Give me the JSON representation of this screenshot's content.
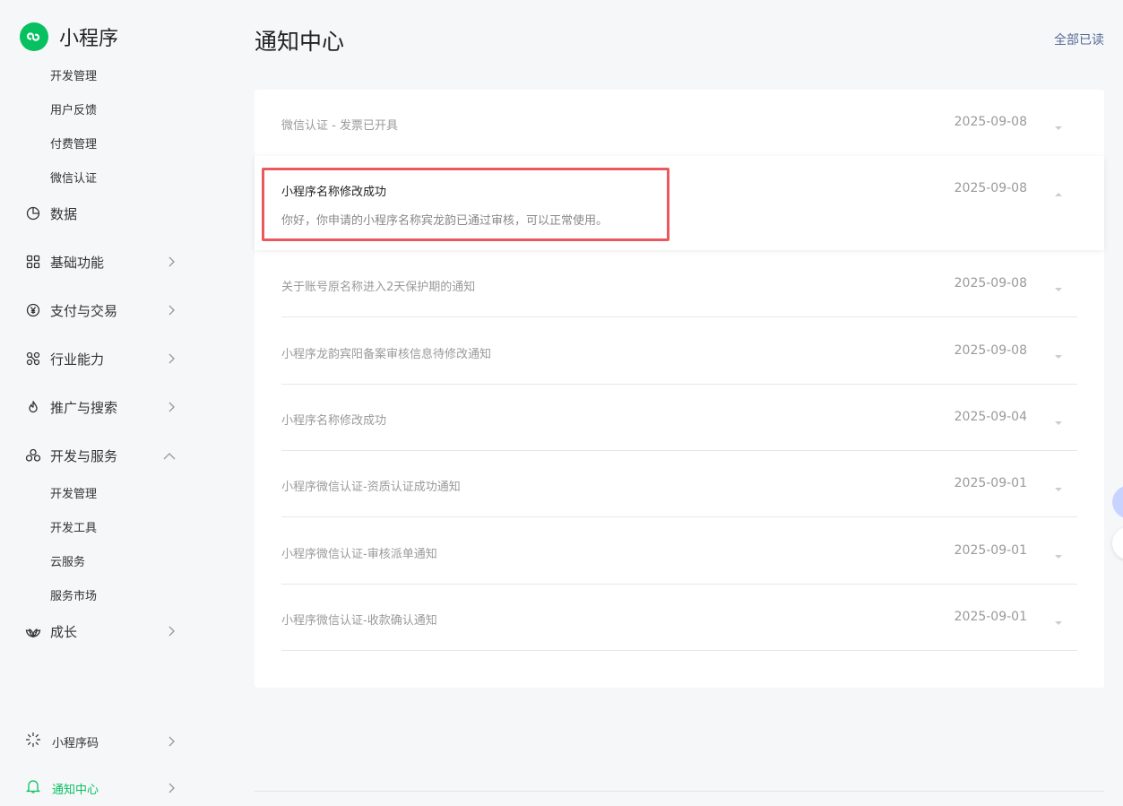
{
  "app": {
    "name": "小程序",
    "brand_color": "#07c160"
  },
  "sidebar": {
    "top_subitems": [
      "开发管理",
      "用户反馈",
      "付费管理",
      "微信认证"
    ],
    "groups": [
      {
        "label": "数据",
        "icon": "pie-chart-icon"
      },
      {
        "label": "基础功能",
        "icon": "grid-icon"
      },
      {
        "label": "支付与交易",
        "icon": "yen-icon"
      },
      {
        "label": "行业能力",
        "icon": "nodes-icon"
      },
      {
        "label": "推广与搜索",
        "icon": "flame-icon"
      },
      {
        "label": "开发与服务",
        "icon": "cluster-icon"
      },
      {
        "label": "成长",
        "icon": "lotus-icon"
      }
    ],
    "dev_subitems": [
      "开发管理",
      "开发工具",
      "云服务",
      "服务市场"
    ],
    "bottom": {
      "miniprogram_code": "小程序码",
      "notification_center": "通知中心"
    }
  },
  "header": {
    "title": "通知中心",
    "mark_all_read": "全部已读"
  },
  "notifications": [
    {
      "title": "微信认证 - 发票已开具",
      "date": "2025-09-08",
      "expanded": false
    },
    {
      "title": "小程序名称修改成功",
      "date": "2025-09-08",
      "expanded": true,
      "body": "你好，你申请的小程序名称宾龙韵已通过审核，可以正常使用。"
    },
    {
      "title": "关于账号原名称进入2天保护期的通知",
      "date": "2025-09-08",
      "expanded": false
    },
    {
      "title": "小程序龙韵宾阳备案审核信息待修改通知",
      "date": "2025-09-08",
      "expanded": false
    },
    {
      "title": "小程序名称修改成功",
      "date": "2025-09-04",
      "expanded": false
    },
    {
      "title": "小程序微信认证-资质认证成功通知",
      "date": "2025-09-01",
      "expanded": false
    },
    {
      "title": "小程序微信认证-审核派单通知",
      "date": "2025-09-01",
      "expanded": false
    },
    {
      "title": "小程序微信认证-收款确认通知",
      "date": "2025-09-01",
      "expanded": false
    }
  ],
  "highlight_color": "#e85a5f"
}
